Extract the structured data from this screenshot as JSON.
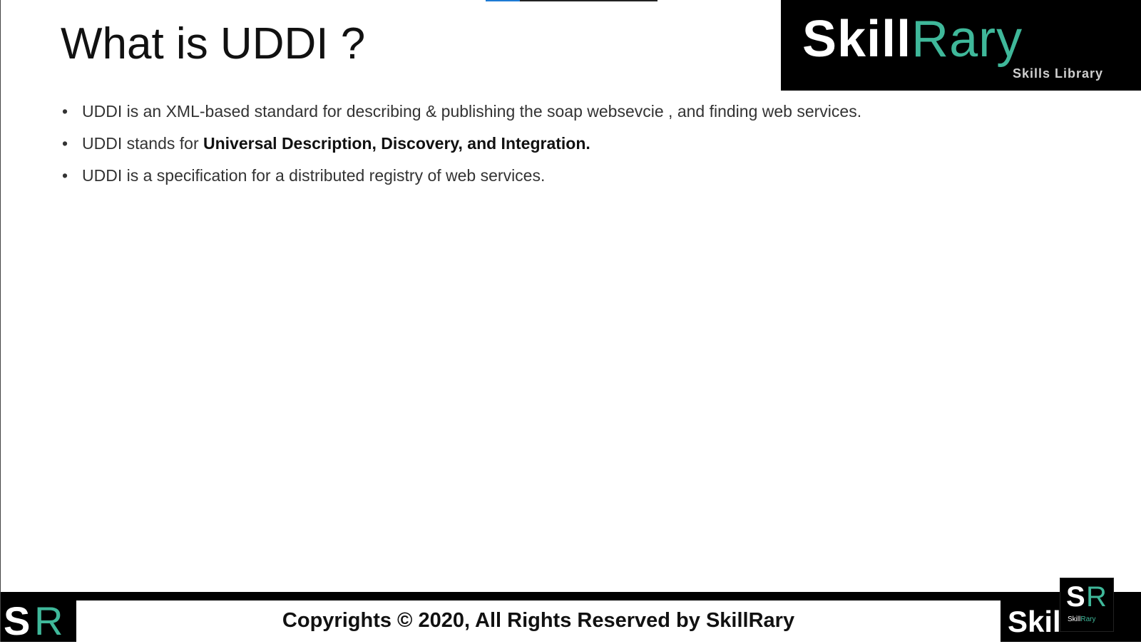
{
  "slide": {
    "title": "What is UDDI ?",
    "progress": 0.2,
    "bullets": [
      {
        "text": "UDDI is an XML-based standard for describing &  publishing the soap websevcie , and finding web services.",
        "bold": ""
      },
      {
        "text": "UDDI stands for ",
        "bold": "Universal Description, Discovery, and Integration."
      },
      {
        "text": "UDDI is a specification for a distributed registry of web services.",
        "bold": ""
      }
    ]
  },
  "logo": {
    "word_a": "Skill",
    "word_b": "Rary",
    "tagline": "Skills Library"
  },
  "footer": {
    "copyright": "Copyrights © 2020, All Rights Reserved by SkillRary",
    "left_mark_s": "S",
    "left_mark_r": "R",
    "right_word": "Skil"
  },
  "badge": {
    "s": "S",
    "r": "R",
    "caption_a": "Skill",
    "caption_b": "Rary"
  },
  "colors": {
    "accent": "#3fb89a",
    "progress": "#1e7bd4",
    "dark": "#000000"
  }
}
